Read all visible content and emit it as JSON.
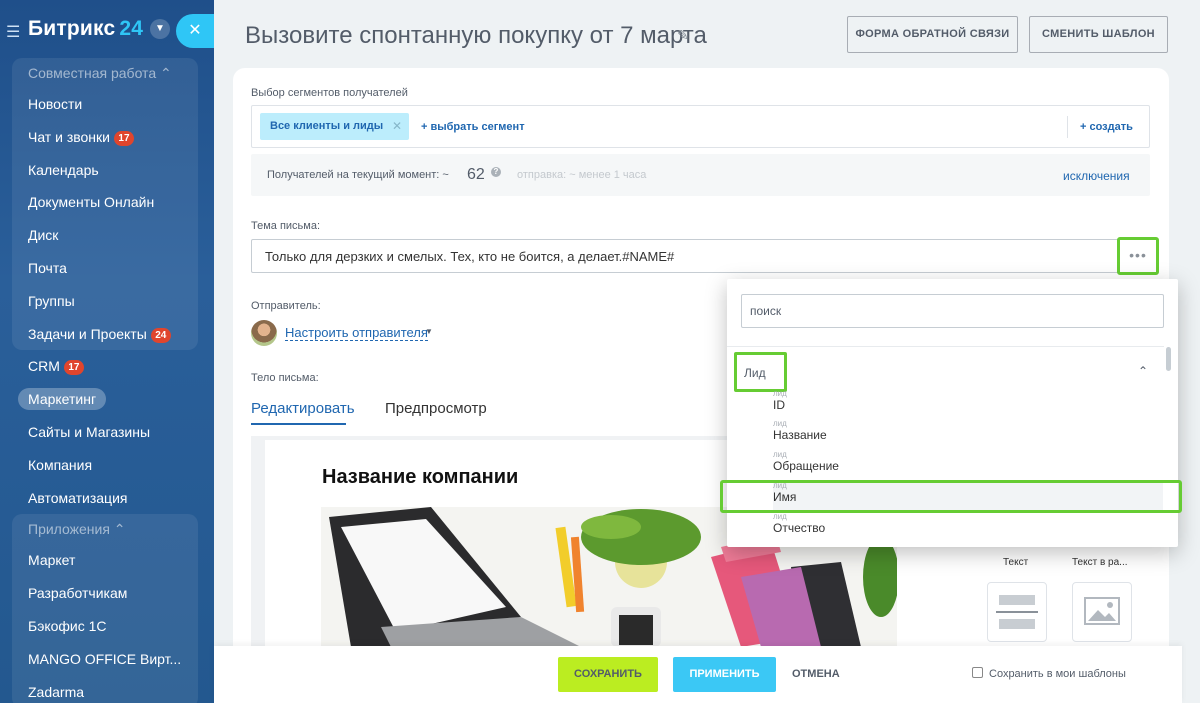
{
  "sidebar": {
    "logo_text": "Битрикс",
    "logo_num": "24",
    "groups": [
      {
        "title": "Совместная работа",
        "items": [
          {
            "label": "Новости",
            "badge": ""
          },
          {
            "label": "Чат и звонки",
            "badge": "17"
          },
          {
            "label": "Календарь",
            "badge": ""
          },
          {
            "label": "Документы Онлайн",
            "badge": ""
          },
          {
            "label": "Диск",
            "badge": ""
          },
          {
            "label": "Почта",
            "badge": ""
          },
          {
            "label": "Группы",
            "badge": ""
          },
          {
            "label": "Задачи и Проекты",
            "badge": "24"
          }
        ]
      },
      {
        "title": "Приложения",
        "items": [
          {
            "label": "Маркет",
            "badge": ""
          },
          {
            "label": "Разработчикам",
            "badge": ""
          },
          {
            "label": "Бэкофис 1С",
            "badge": ""
          },
          {
            "label": "MANGO OFFICE Вирт...",
            "badge": ""
          },
          {
            "label": "Zadarma",
            "badge": ""
          }
        ]
      }
    ],
    "plain_items": [
      {
        "label": "CRM",
        "badge": "17"
      },
      {
        "label": "Маркетинг",
        "badge": ""
      },
      {
        "label": "Сайты и Магазины",
        "badge": ""
      },
      {
        "label": "Компания",
        "badge": ""
      },
      {
        "label": "Автоматизация",
        "badge": ""
      }
    ]
  },
  "header": {
    "title": "Вызовите спонтанную покупку от 7 марта",
    "feedback_btn": "ФОРМА ОБРАТНОЙ СВЯЗИ",
    "template_btn": "СМЕНИТЬ ШАБЛОН"
  },
  "segments": {
    "label": "Выбор сегментов получателей",
    "tag": "Все клиенты и лиды",
    "choose": "выбрать сегмент",
    "create": "создать"
  },
  "recipients": {
    "text": "Получателей на текущий момент: ~",
    "count": "62",
    "hint": "отправка: ~ менее 1 часа",
    "exclusions": "исключения"
  },
  "subject": {
    "label": "Тема письма:",
    "value": "Только для дерзких и смелых. Тех, кто не боится, а делает.#NAME#"
  },
  "sender": {
    "label": "Отправитель:",
    "link": "Настроить отправителя"
  },
  "body": {
    "label": "Тело письма:",
    "tab_edit": "Редактировать",
    "tab_preview": "Предпросмотр",
    "company": "Название компании",
    "blocks": [
      "Текст",
      "Текст в ра..."
    ]
  },
  "popup": {
    "search_placeholder": "поиск",
    "section": "Лид",
    "fields": [
      {
        "cat": "лид",
        "name": "ID"
      },
      {
        "cat": "лид",
        "name": "Название"
      },
      {
        "cat": "лид",
        "name": "Обращение"
      },
      {
        "cat": "лид",
        "name": "Имя"
      },
      {
        "cat": "лид",
        "name": "Отчество"
      }
    ]
  },
  "footer": {
    "save": "СОХРАНИТЬ",
    "apply": "ПРИМЕНИТЬ",
    "cancel": "ОТМЕНА",
    "save_template": "Сохранить в мои шаблоны"
  },
  "colors": {
    "sidebar": "#1f4f8a",
    "accent_blue": "#2067b0",
    "save_green": "#bbed21",
    "apply_blue": "#3bc8f5",
    "highlight_green": "#66cc33",
    "badge_red": "#e0452d"
  }
}
